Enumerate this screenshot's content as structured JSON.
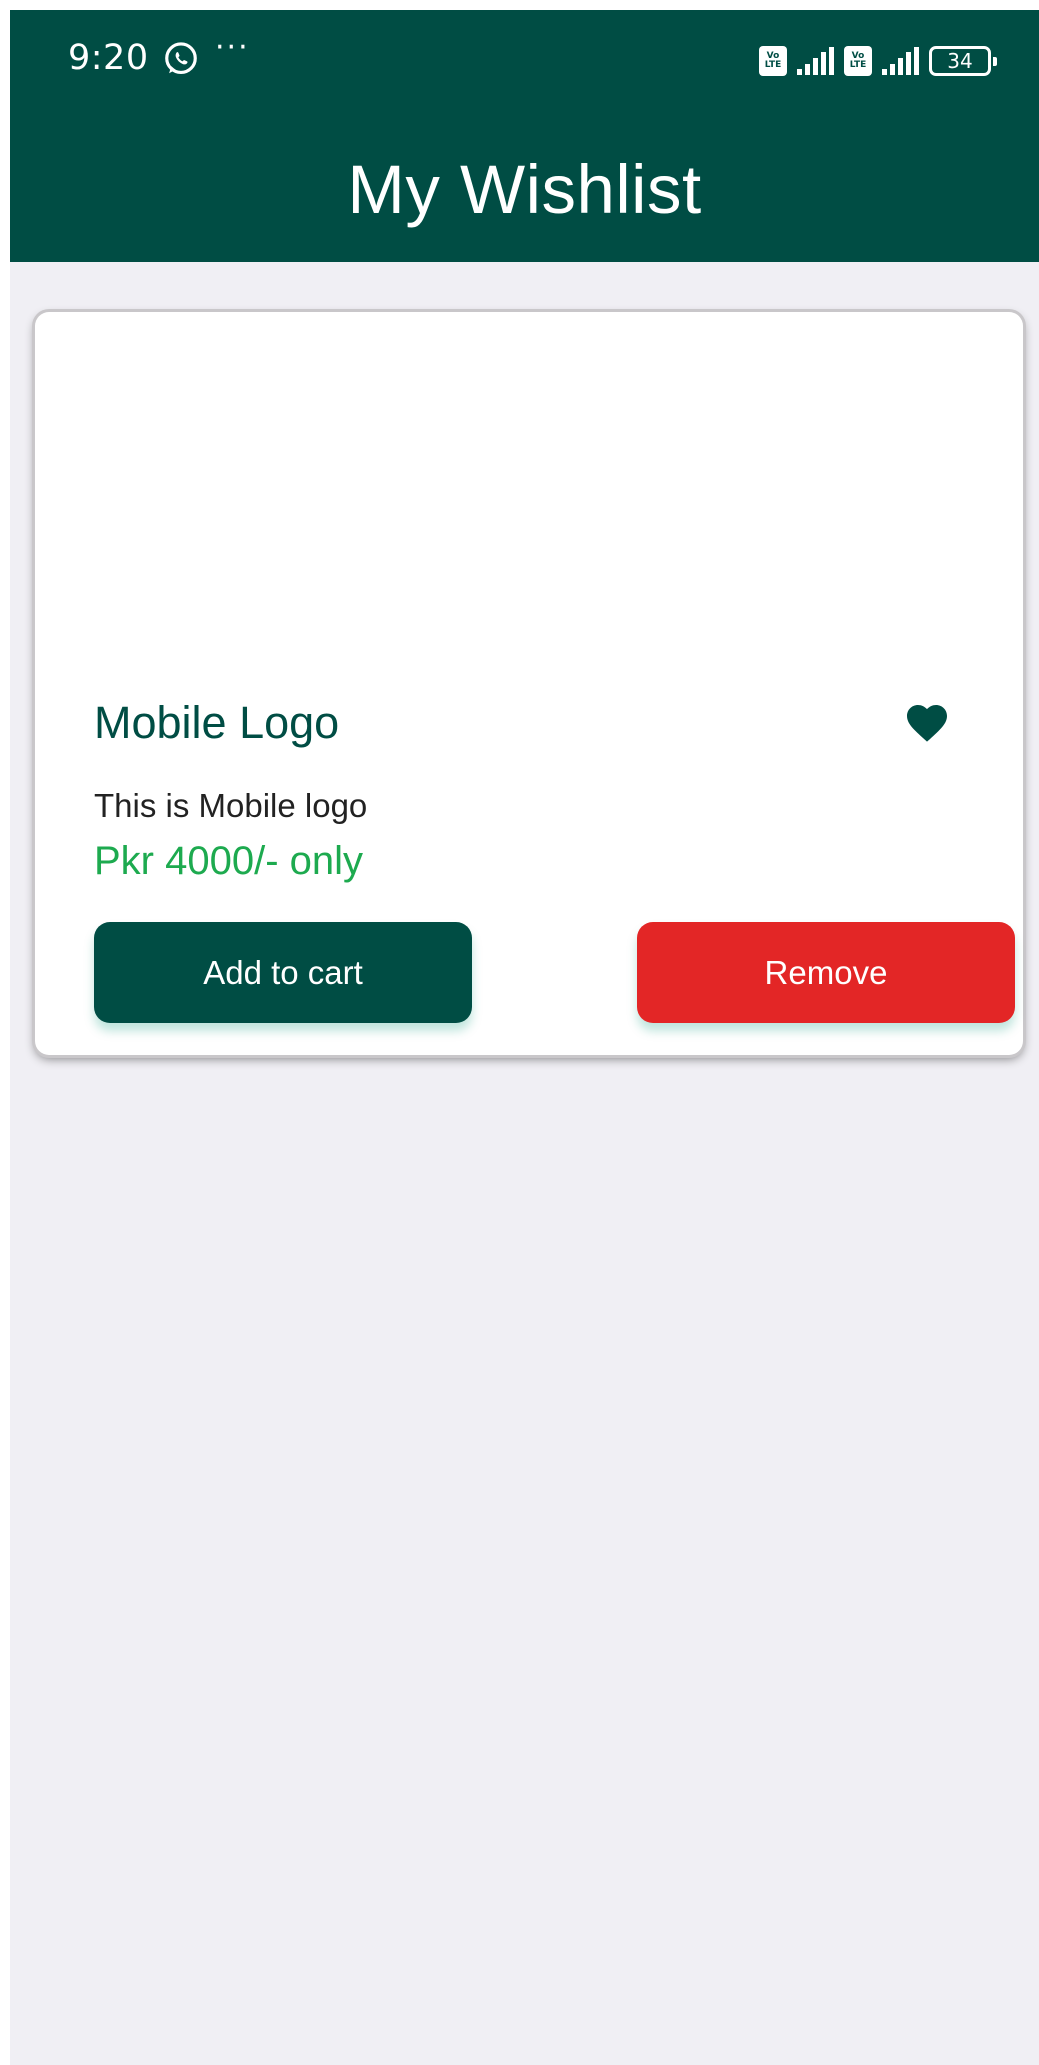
{
  "status_bar": {
    "time": "9:20",
    "more": "···",
    "volte_1": "Vo LTE",
    "volte_2": "Vo LTE",
    "battery": "34"
  },
  "header": {
    "title": "My Wishlist"
  },
  "wishlist": {
    "items": [
      {
        "name": "Mobile Logo",
        "description": "This is Mobile logo",
        "price": "Pkr 4000/- only",
        "favorite": true,
        "add_to_cart_label": "Add to cart",
        "remove_label": "Remove"
      }
    ]
  },
  "colors": {
    "primary": "#004d44",
    "price": "#1daa4f",
    "danger": "#e32626",
    "background": "#f0eff4"
  },
  "icons": {
    "whatsapp": "whatsapp-icon",
    "favorite": "heart-icon"
  }
}
